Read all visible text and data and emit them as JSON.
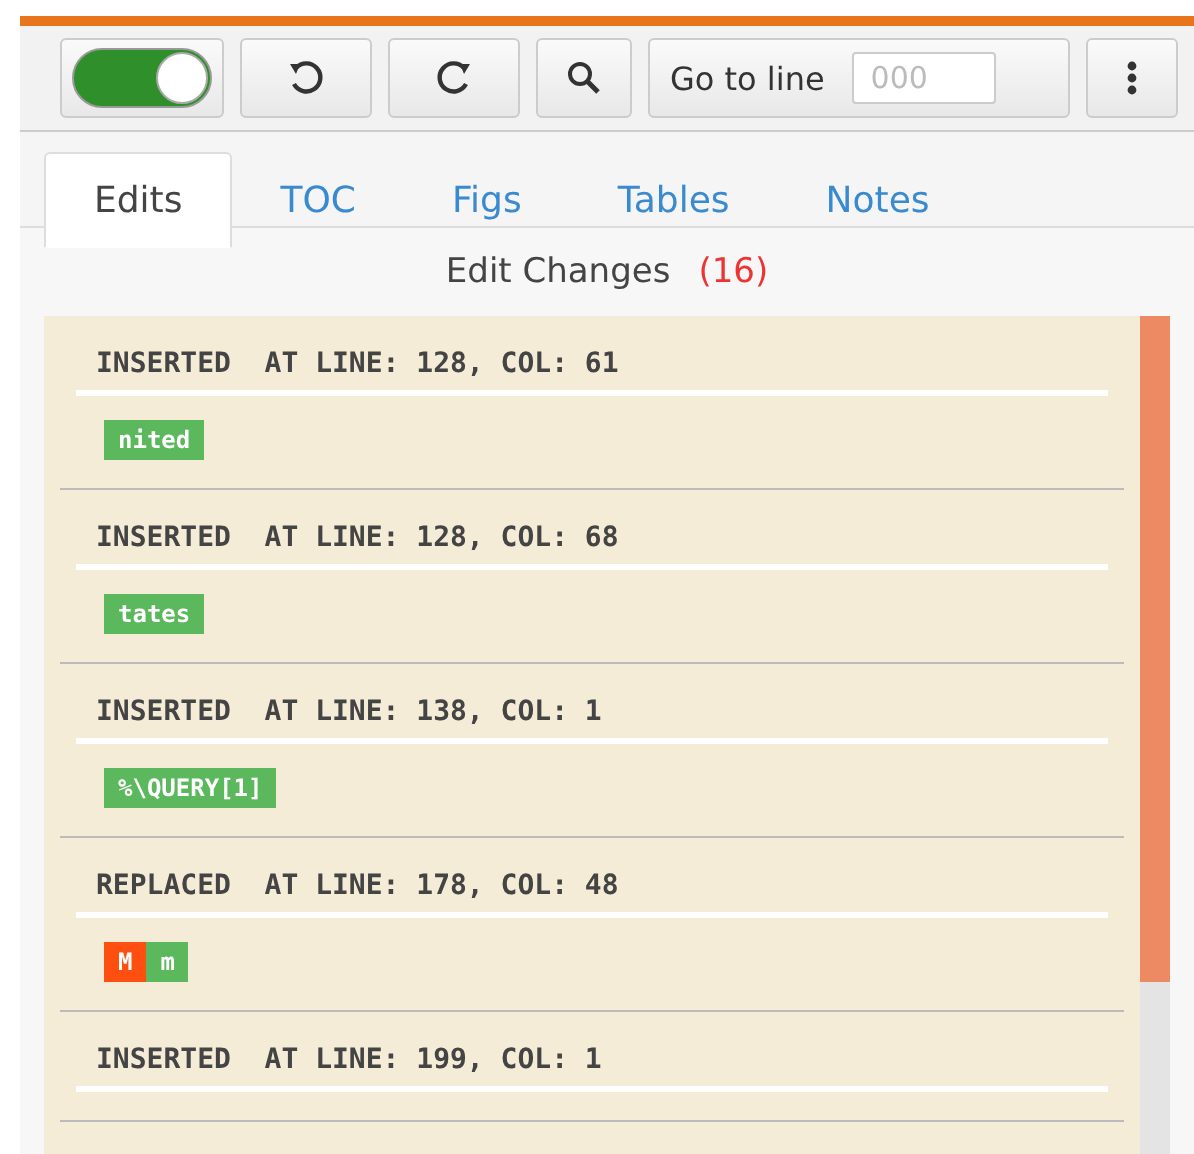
{
  "toolbar": {
    "toggle": {
      "on": true
    },
    "goto": {
      "label": "Go to line",
      "placeholder": "000"
    }
  },
  "tabs": [
    {
      "label": "Edits",
      "selected": true
    },
    {
      "label": "TOC",
      "selected": false
    },
    {
      "label": "Figs",
      "selected": false
    },
    {
      "label": "Tables",
      "selected": false
    },
    {
      "label": "Notes",
      "selected": false
    }
  ],
  "header": {
    "title": "Edit Changes",
    "count": "(16)"
  },
  "edits": [
    {
      "action": "INSERTED",
      "location": "AT LINE: 128, COL: 61",
      "chips": [
        {
          "kind": "inserted",
          "text": "nited"
        }
      ]
    },
    {
      "action": "INSERTED",
      "location": "AT LINE: 128, COL: 68",
      "chips": [
        {
          "kind": "inserted",
          "text": "tates"
        }
      ]
    },
    {
      "action": "INSERTED",
      "location": "AT LINE: 138, COL: 1",
      "chips": [
        {
          "kind": "inserted",
          "text": "%\\QUERY[1]"
        }
      ]
    },
    {
      "action": "REPLACED",
      "location": "AT LINE: 178, COL: 48",
      "chips": [
        {
          "kind": "deleted",
          "text": "M"
        },
        {
          "kind": "inserted",
          "text": "m"
        }
      ]
    },
    {
      "action": "INSERTED",
      "location": "AT LINE: 199, COL: 1"
    }
  ]
}
